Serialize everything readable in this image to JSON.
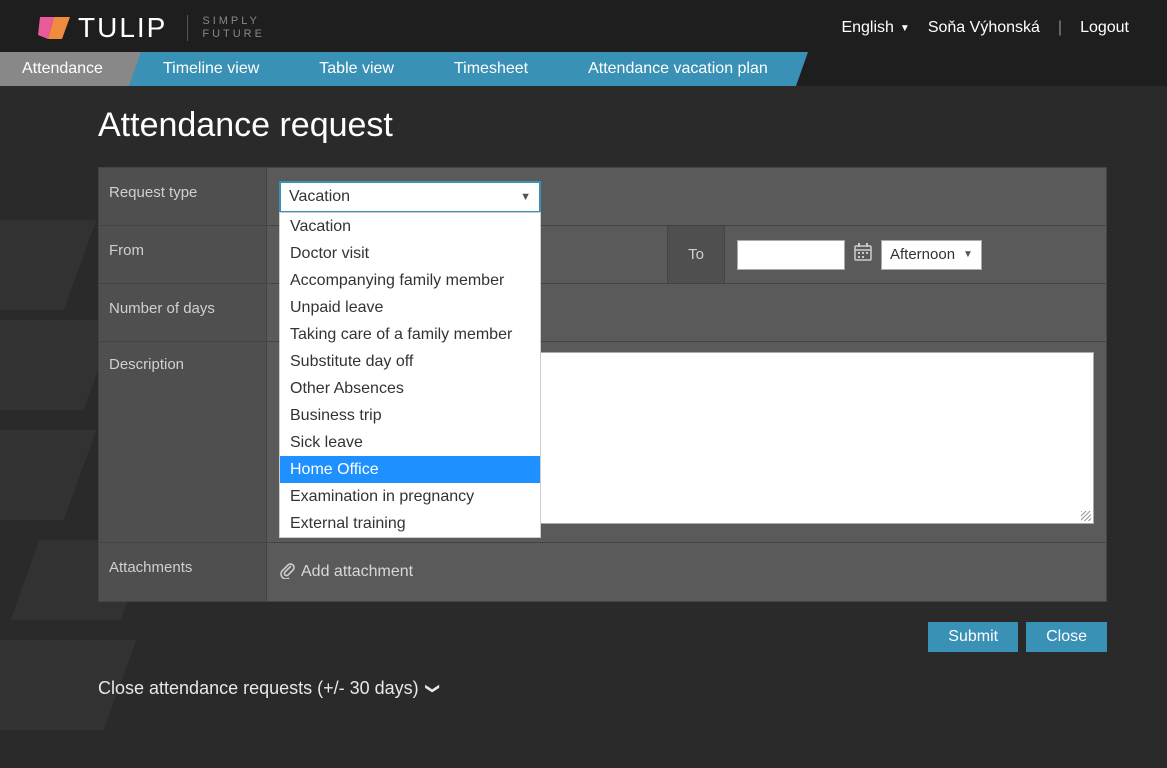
{
  "brand": {
    "name": "TULIP",
    "sub1": "SIMPLY",
    "sub2": "FUTURE"
  },
  "header": {
    "language": "English",
    "user": "Soňa Výhonská",
    "logout": "Logout"
  },
  "nav": {
    "attendance": "Attendance",
    "timeline": "Timeline view",
    "table": "Table view",
    "timesheet": "Timesheet",
    "vacation_plan": "Attendance vacation plan"
  },
  "page": {
    "title": "Attendance request"
  },
  "form": {
    "request_type_label": "Request type",
    "request_type_value": "Vacation",
    "request_type_options": [
      "Vacation",
      "Doctor visit",
      "Accompanying family member",
      "Unpaid leave",
      "Taking care of a family member",
      "Substitute day off",
      "Other Absences",
      "Business trip",
      "Sick leave",
      "Home Office",
      "Examination in pregnancy",
      "External training"
    ],
    "highlighted_option_index": 9,
    "from_label": "From",
    "to_label": "To",
    "to_daypart": "Afternoon",
    "days_label": "Number of days",
    "description_label": "Description",
    "attachments_label": "Attachments",
    "add_attachment": "Add attachment",
    "submit": "Submit",
    "close": "Close"
  },
  "footer": {
    "close_requests": "Close attendance requests (+/- 30 days)"
  }
}
